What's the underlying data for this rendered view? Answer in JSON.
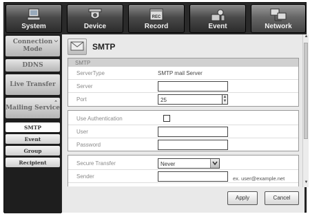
{
  "tabs": [
    {
      "label": "System",
      "icon": "system-monitor-icon"
    },
    {
      "label": "Device",
      "icon": "device-camera-icon"
    },
    {
      "label": "Record",
      "icon": "record-icon"
    },
    {
      "label": "Event",
      "icon": "event-icon"
    },
    {
      "label": "Network",
      "icon": "network-icon",
      "active": true
    }
  ],
  "record_badge": "REC",
  "sidebar": {
    "items": [
      {
        "label": "Connection Mode"
      },
      {
        "label": "DDNS"
      },
      {
        "label": "Live Transfer"
      },
      {
        "label": "Mailing Service"
      }
    ],
    "subitems": [
      {
        "label": "SMTP",
        "selected": true
      },
      {
        "label": "Event"
      },
      {
        "label": "Group"
      },
      {
        "label": "Recipient"
      }
    ]
  },
  "page": {
    "title": "SMTP",
    "icon": "smtp-mail-icon"
  },
  "smtp": {
    "section_label": "SMTP",
    "server_type_label": "ServerType",
    "server_type_value": "SMTP mail Server",
    "server_label": "Server",
    "server_value": "",
    "port_label": "Port",
    "port_value": "25",
    "use_auth_label": "Use Authentication",
    "use_auth_checked": false,
    "user_label": "User",
    "user_value": "",
    "password_label": "Password",
    "password_value": "",
    "secure_transfer_label": "Secure Transfer",
    "secure_transfer_value": "Never",
    "sender_label": "Sender",
    "sender_value": "",
    "sender_hint": "ex. user@example.net"
  },
  "buttons": {
    "apply": "Apply",
    "cancel": "Cancel"
  }
}
